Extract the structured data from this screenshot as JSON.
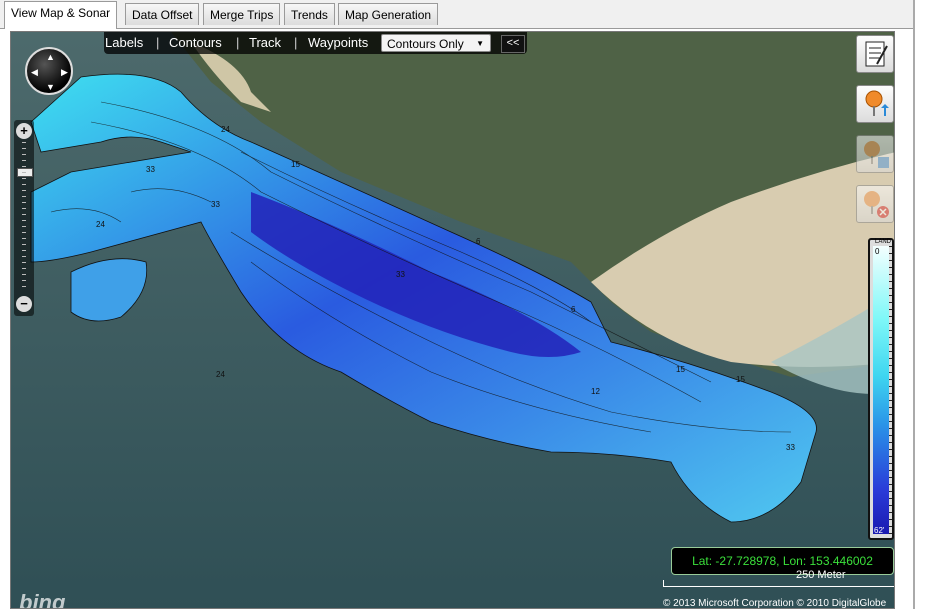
{
  "tabs": [
    {
      "label": "View Map & Sonar",
      "active": true
    },
    {
      "label": "Data Offset"
    },
    {
      "label": "Merge Trips"
    },
    {
      "label": "Trends"
    },
    {
      "label": "Map Generation"
    }
  ],
  "map": {
    "toolbar": {
      "labels": "Labels",
      "contours": "Contours",
      "track": "Track",
      "waypoints": "Waypoints",
      "separator": "|",
      "mode_select": "Contours Only",
      "collapse": "<<"
    },
    "legend": {
      "top_label": "LAND",
      "min": "0",
      "max": "62'",
      "colors": [
        "#f4ffff",
        "#80f8f8",
        "#3fd6f0",
        "#2a94e8",
        "#2a3ad8",
        "#1a1ab0"
      ]
    },
    "coords": "Lat: -27.728978, Lon: 153.446002",
    "scale": "250 Meter",
    "copyright": "© 2013 Microsoft Corporation   © 2010 DigitalGlobe",
    "brand": "bing",
    "contour_labels": [
      "24",
      "33",
      "33",
      "24",
      "15",
      "6",
      "33",
      "24",
      "12",
      "15",
      "33",
      "6",
      "15"
    ]
  }
}
